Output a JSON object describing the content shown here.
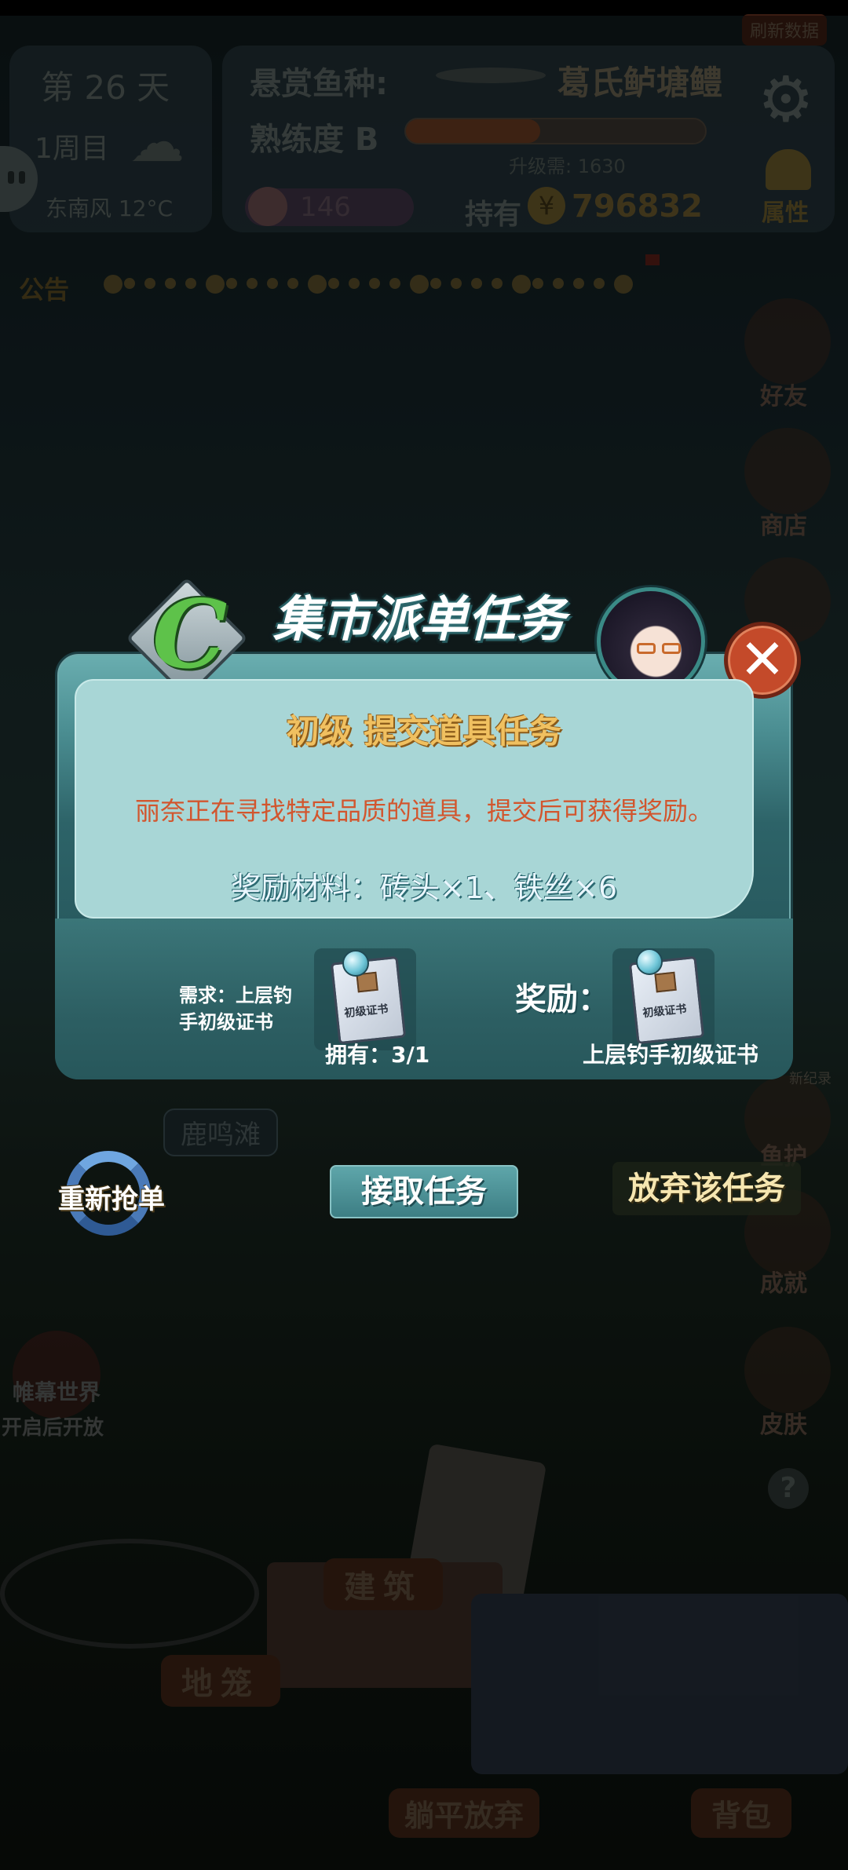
{
  "hud": {
    "day": "第 26 天",
    "week": "1周目",
    "weather": "东南风 12°C",
    "bounty_label": "悬赏鱼种:",
    "bounty_fish": "葛氏鲈塘鳢",
    "proficiency": "熟练度 B",
    "proficiency_progress": 0.45,
    "upgrade_need": "升级需: 1630",
    "gems": "146",
    "holding_label": "持有",
    "money": "796832",
    "attributes": "属性",
    "refresh": "刷新数据",
    "announcement": "公告"
  },
  "side_menu": {
    "friends": "好友",
    "shop": "商店",
    "fish_guard": "鱼护",
    "achievements": "成就",
    "skins": "皮肤",
    "new_record": "新纪录"
  },
  "left_menu": {
    "location": "鹿鸣滩",
    "curtain_world": "帷幕世界",
    "unlock_hint": "开启后开放"
  },
  "bottom_menu": {
    "build": "建筑",
    "cage": "地笼",
    "lie_flat": "躺平放弃",
    "backpack": "背包"
  },
  "dialog": {
    "title": "集市派单任务",
    "grade_letter": "C",
    "npc_name": "丽奈",
    "task_title": "初级 提交道具任务",
    "description": "丽奈正在寻找特定品质的道具，提交后可获得奖励。",
    "reward_materials": "奖励材料：砖头×1、铁丝×6",
    "requirement_label": "需求：上层钓",
    "requirement_label2": "手初级证书",
    "owned": "拥有：3/1",
    "reward_label": "奖励：",
    "reward_item": "上层钓手初级证书",
    "book_title": "初级证书"
  },
  "actions": {
    "reroll": "重新抢单",
    "accept": "接取任务",
    "abandon": "放弃该任务"
  },
  "colors": {
    "gold_title": "#f0c060",
    "desc_red": "#d2562e",
    "reward_blue": "#eaf7ff",
    "close_red": "#c44a2a"
  }
}
